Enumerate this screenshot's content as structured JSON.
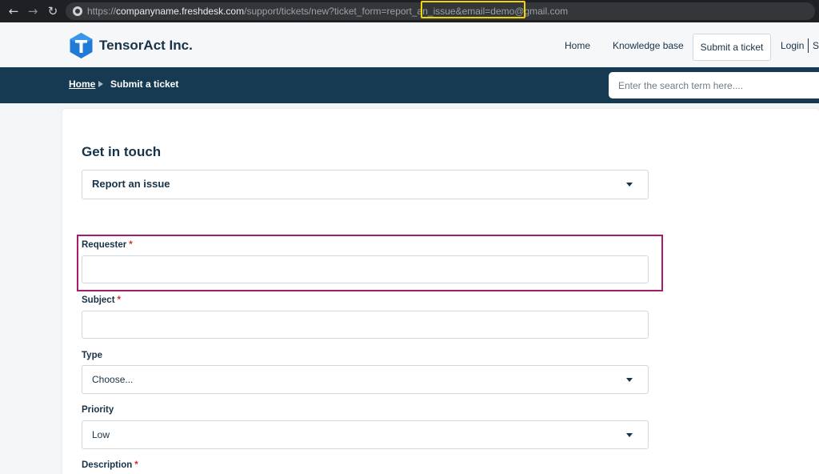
{
  "browser": {
    "url_prefix": "https://",
    "url_host": "companyname.freshdesk.com",
    "url_path": "/support/tickets/new?ticket_form=report_an_issue&email=demo@gmail.com"
  },
  "header": {
    "brand": "TensorAct Inc.",
    "nav": {
      "home": "Home",
      "knowledge_base": "Knowledge base",
      "submit_ticket": "Submit a ticket",
      "login": "Login",
      "signup": "Si"
    }
  },
  "breadcrumb": {
    "home": "Home",
    "current": "Submit a ticket"
  },
  "search": {
    "placeholder": "Enter the search term here...."
  },
  "form": {
    "title": "Get in touch",
    "form_type": "Report an issue",
    "requester_label": "Requester",
    "subject_label": "Subject",
    "type_label": "Type",
    "type_value": "Choose...",
    "priority_label": "Priority",
    "priority_value": "Low",
    "description_label": "Description",
    "required_mark": "*"
  },
  "colors": {
    "band": "#163a52",
    "text": "#183247",
    "url_highlight": "#f0d500",
    "field_highlight": "#a51d6c",
    "required": "#d72d30"
  }
}
